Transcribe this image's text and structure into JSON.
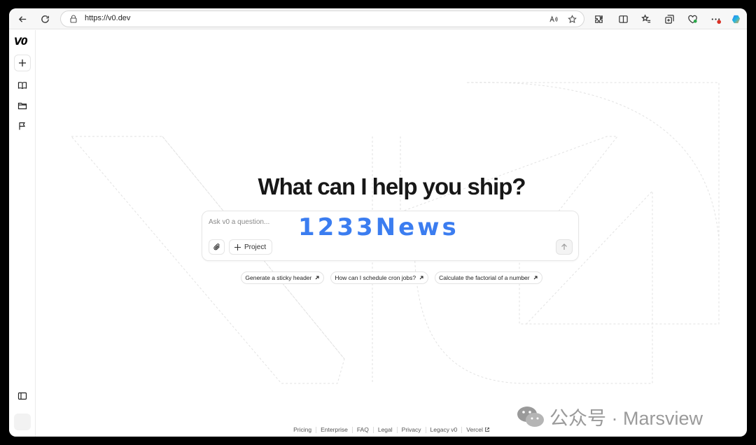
{
  "browser": {
    "url": "https://v0.dev",
    "notification_badge": "1"
  },
  "sidebar": {
    "logo": "V0"
  },
  "main": {
    "headline": "What can I help you ship?",
    "prompt": {
      "placeholder": "Ask v0 a question...",
      "project_label": "Project"
    },
    "suggestions": [
      "Generate a sticky header",
      "How can I schedule cron jobs?",
      "Calculate the factorial of a number"
    ],
    "overlay_watermark": "1233News"
  },
  "footer": {
    "links": [
      "Pricing",
      "Enterprise",
      "FAQ",
      "Legal",
      "Privacy",
      "Legacy v0",
      "Vercel"
    ]
  },
  "wechat_watermark": {
    "text": "公众号 · Marsview"
  },
  "colors": {
    "accent_blue": "#3b7df0",
    "headline": "#171717",
    "badge_red": "#d93025"
  }
}
